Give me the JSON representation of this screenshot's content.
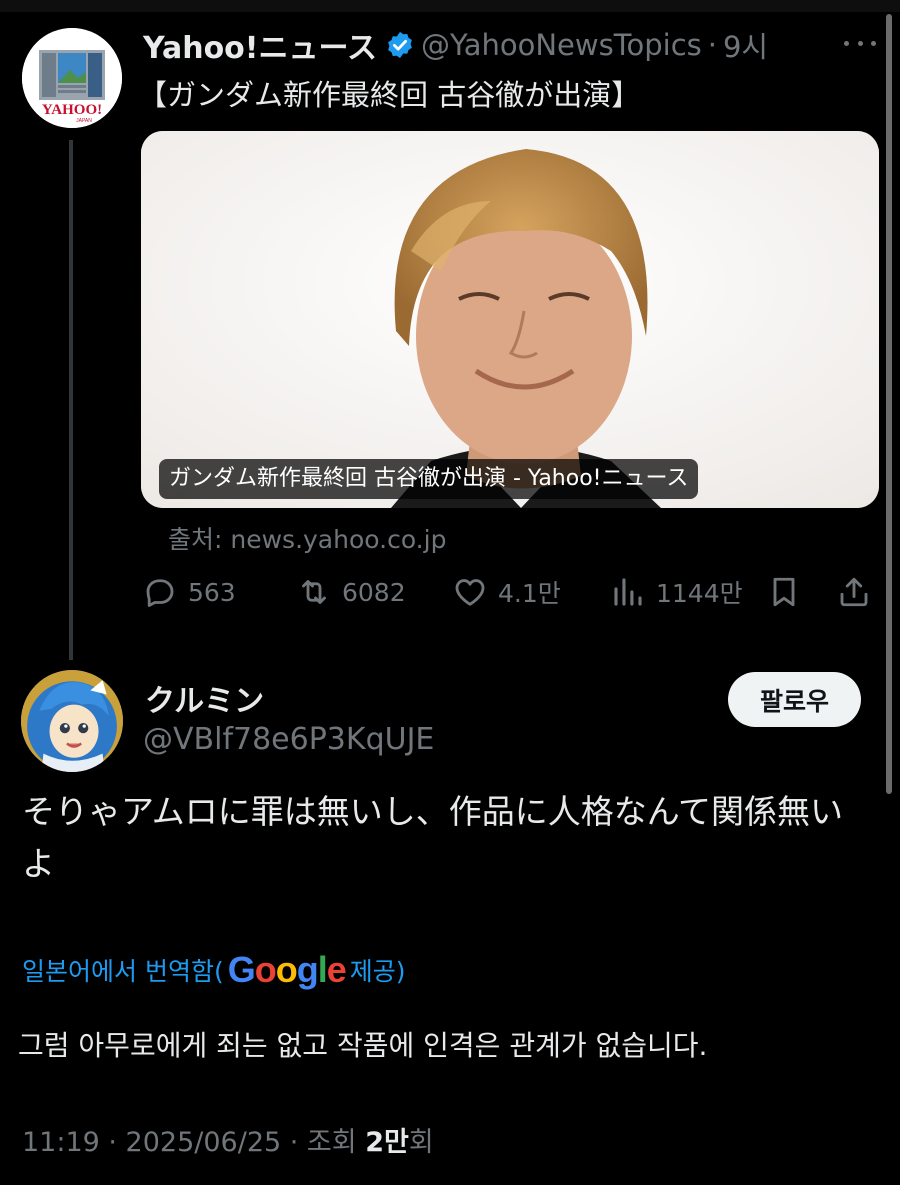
{
  "parent_tweet": {
    "author_name": "Yahoo!ニュース",
    "handle": "@YahooNewsTopics",
    "separator": "·",
    "time": "9시",
    "avatar_text": "YAHOO!",
    "avatar_subtext": "JAPAN",
    "text": "【ガンダム新作最終回 古谷徹が出演】",
    "card": {
      "caption": "ガンダム新作最終回 古谷徹が出演 - Yahoo!ニュース"
    },
    "source": "출처: news.yahoo.co.jp",
    "actions": {
      "replies": "563",
      "retweets": "6082",
      "likes": "4.1만",
      "views": "1144만"
    }
  },
  "reply_tweet": {
    "author_name": "クルミン",
    "handle": "@VBlf78e6P3KqUJE",
    "follow_label": "팔로우",
    "text": "そりゃアムロに罪は無いし、作品に人格なんて関係無いよ",
    "translation_prefix": "일본어에서 번역함(",
    "translation_logo": "Google",
    "translation_suffix": " 제공)",
    "translated_text": "그럼 아무로에게 죄는 없고 작품에 인격은 관계가 없습니다.",
    "meta": {
      "time": "11:19 · 2025/06/25 · 조회 ",
      "views_bold": "2만",
      "views_suffix": "회"
    }
  },
  "colors": {
    "background": "#000000",
    "text_primary": "#e7e9ea",
    "text_secondary": "#71767b",
    "link_blue": "#1d9bf0",
    "verified_blue": "#1d9bf0"
  }
}
